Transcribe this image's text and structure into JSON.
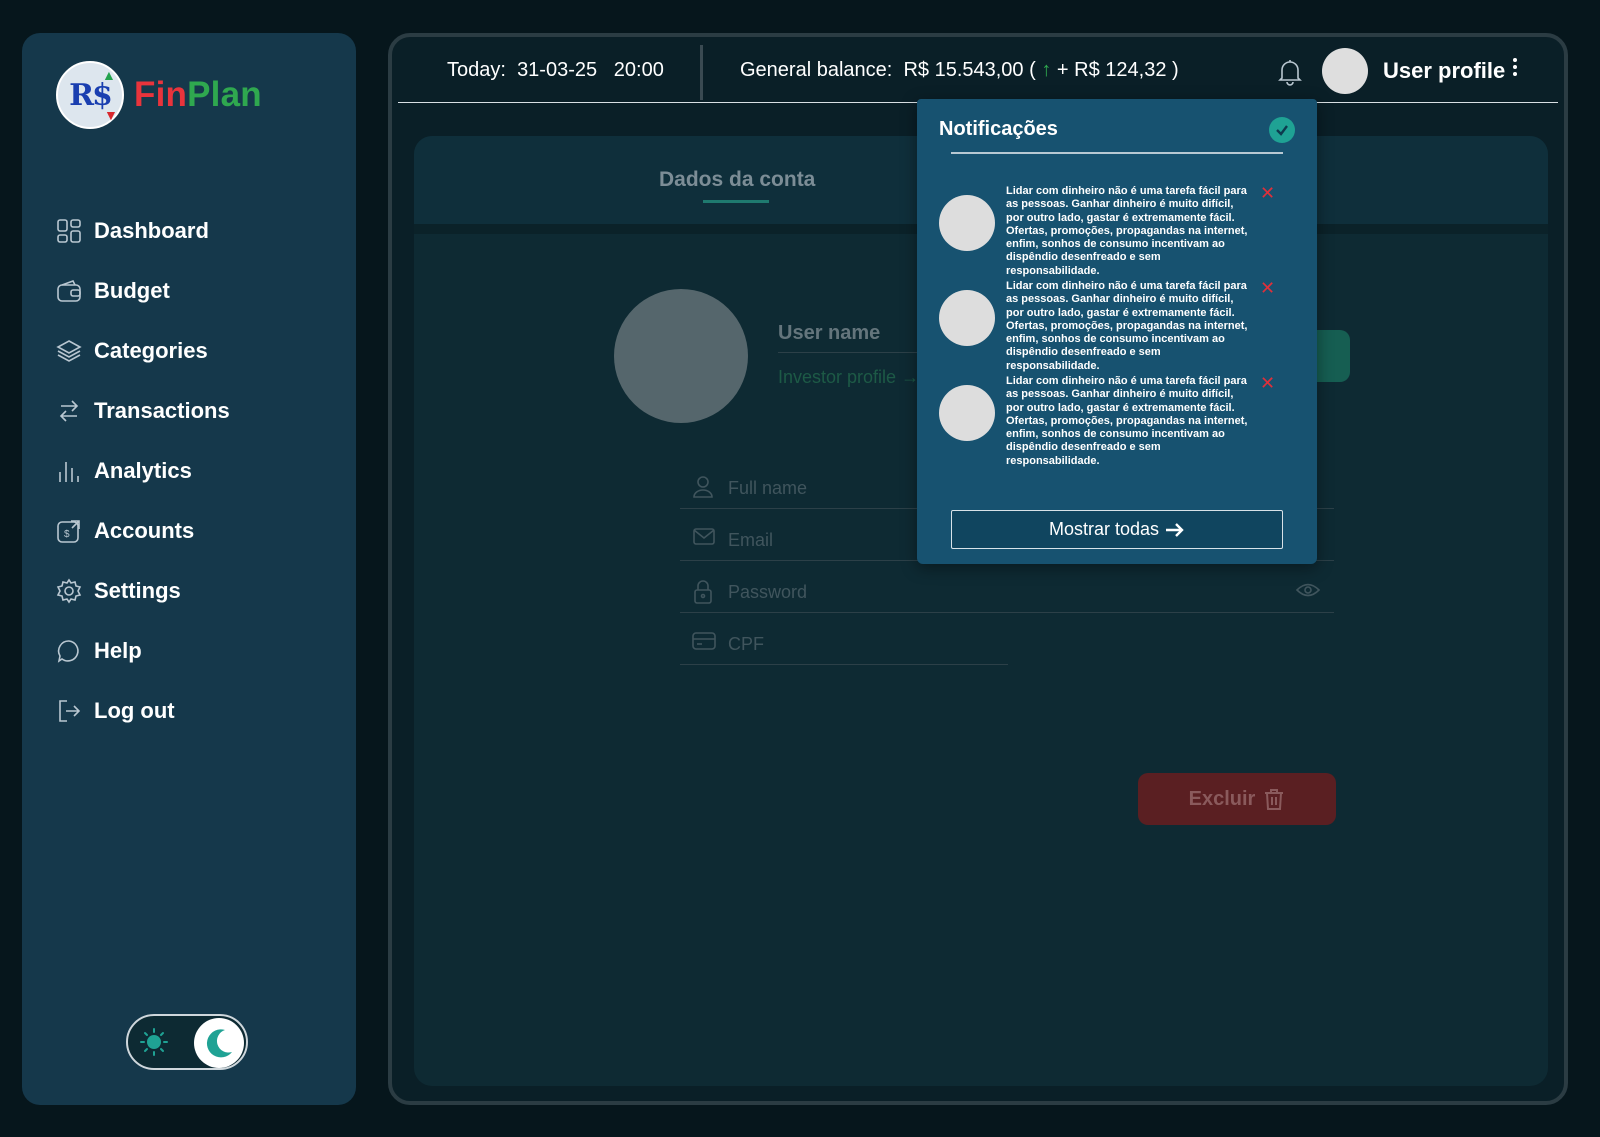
{
  "brand": {
    "logo_mark": "R$",
    "name_part1": "Fin",
    "name_part2": "Plan"
  },
  "sidebar": {
    "items": [
      {
        "label": "Dashboard",
        "icon": "grid-icon"
      },
      {
        "label": "Budget",
        "icon": "wallet-icon"
      },
      {
        "label": "Categories",
        "icon": "layers-icon"
      },
      {
        "label": "Transactions",
        "icon": "swap-icon"
      },
      {
        "label": "Analytics",
        "icon": "bar-chart-icon"
      },
      {
        "label": "Accounts",
        "icon": "account-icon"
      },
      {
        "label": "Settings",
        "icon": "gear-icon"
      },
      {
        "label": "Help",
        "icon": "chat-bubble-icon"
      },
      {
        "label": "Log out",
        "icon": "logout-icon"
      }
    ],
    "theme": {
      "active": "dark"
    }
  },
  "header": {
    "today_label": "Today:",
    "date": "31-03-25",
    "time": "20:00",
    "balance_label": "General balance:",
    "balance_value": "R$ 15.543,00",
    "balance_change": "+ R$ 124,32",
    "profile_label": "User profile"
  },
  "account": {
    "tab_label": "Dados da conta",
    "user_name": "User name",
    "investor_profile": "Investor profile",
    "fields": {
      "full_name_placeholder": "Full name",
      "email_placeholder": "Email",
      "password_placeholder": "Password",
      "cpf_placeholder": "CPF"
    },
    "delete_label": "Excluir"
  },
  "notifications": {
    "title": "Notificações",
    "items": [
      {
        "text": "Lidar com dinheiro não é uma tarefa fácil para as pessoas. Ganhar dinheiro é muito difícil, por outro lado, gastar é extremamente fácil. Ofertas, promoções, propagandas na internet, enfim, sonhos de consumo incentivam ao dispêndio desenfreado e sem responsabilidade."
      },
      {
        "text": "Lidar com dinheiro não é uma tarefa fácil para as pessoas. Ganhar dinheiro é muito difícil, por outro lado, gastar é extremamente fácil. Ofertas, promoções, propagandas na internet, enfim, sonhos de consumo incentivam ao dispêndio desenfreado e sem responsabilidade."
      },
      {
        "text": "Lidar com dinheiro não é uma tarefa fácil para as pessoas. Ganhar dinheiro é muito difícil, por outro lado, gastar é extremamente fácil. Ofertas, promoções, propagandas na internet, enfim, sonhos de consumo incentivam ao dispêndio desenfreado e sem responsabilidade."
      }
    ],
    "show_all_label": "Mostrar todas"
  },
  "colors": {
    "sidebar_bg": "#15384b",
    "page_bg": "#06161c",
    "popup_bg": "#175270",
    "accent_green": "#2fa84f",
    "brand_red": "#e8343c",
    "danger_red": "#e0303a",
    "teal": "#1fa294"
  }
}
